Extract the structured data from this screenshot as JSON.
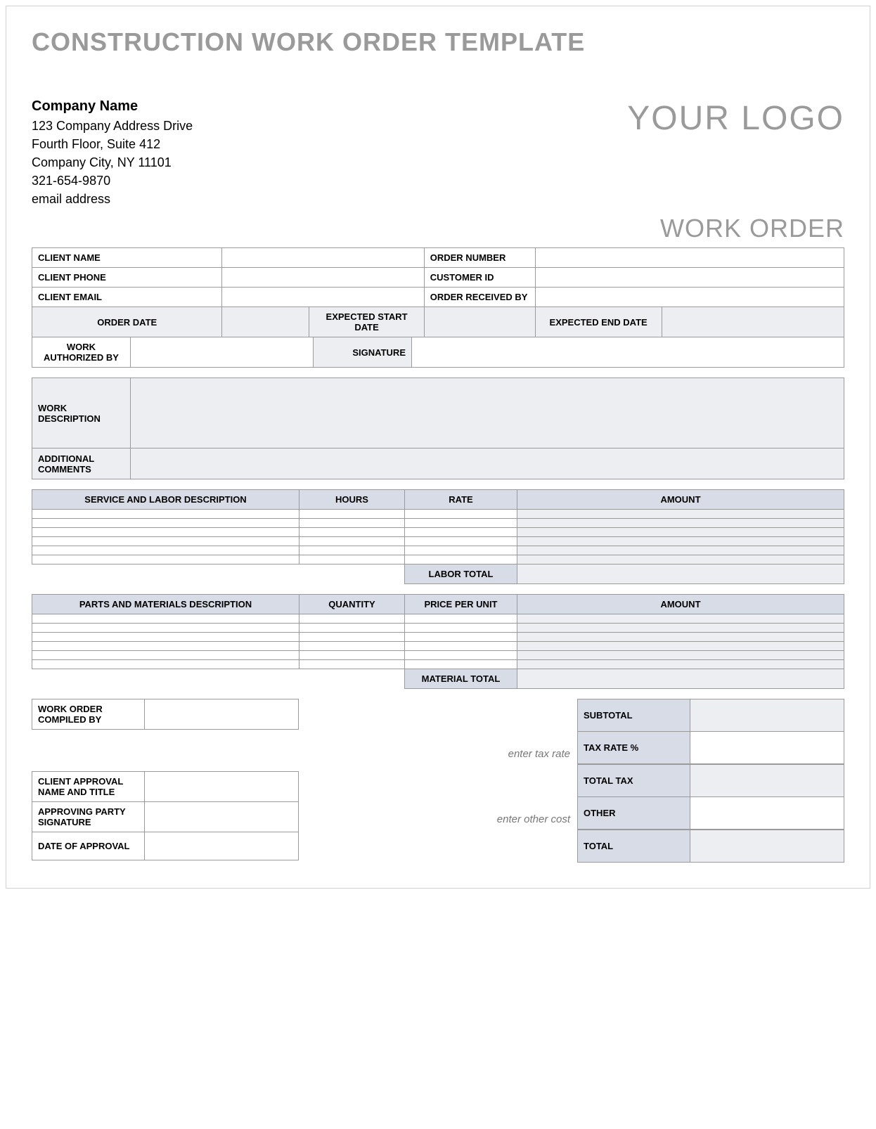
{
  "title": "CONSTRUCTION WORK ORDER TEMPLATE",
  "company": {
    "name": "Company Name",
    "address1": "123 Company Address Drive",
    "address2": "Fourth Floor, Suite 412",
    "city_line": "Company City, NY  11101",
    "phone": "321-654-9870",
    "email": "email address"
  },
  "logo_text": "YOUR LOGO",
  "doc_label": "WORK ORDER",
  "fields": {
    "client_name": "CLIENT NAME",
    "client_phone": "CLIENT PHONE",
    "client_email": "CLIENT EMAIL",
    "order_number": "ORDER NUMBER",
    "customer_id": "CUSTOMER ID",
    "order_received_by": "ORDER RECEIVED BY",
    "order_date": "ORDER DATE",
    "expected_start": "EXPECTED START DATE",
    "expected_end": "EXPECTED END DATE",
    "work_auth_by": "WORK AUTHORIZED BY",
    "signature": "SIGNATURE",
    "work_description": "WORK DESCRIPTION",
    "additional_comments": "ADDITIONAL COMMENTS"
  },
  "labor": {
    "headers": {
      "description": "SERVICE AND LABOR DESCRIPTION",
      "hours": "HOURS",
      "rate": "RATE",
      "amount": "AMOUNT"
    },
    "total_label": "LABOR TOTAL",
    "rows": [
      "",
      "",
      "",
      "",
      "",
      ""
    ]
  },
  "materials": {
    "headers": {
      "description": "PARTS AND MATERIALS DESCRIPTION",
      "quantity": "QUANTITY",
      "price": "PRICE PER UNIT",
      "amount": "AMOUNT"
    },
    "total_label": "MATERIAL TOTAL",
    "rows": [
      "",
      "",
      "",
      "",
      "",
      ""
    ]
  },
  "compiled": {
    "label": "WORK ORDER COMPILED BY"
  },
  "approval": {
    "name_title": "CLIENT APPROVAL NAME AND TITLE",
    "signature": "APPROVING PARTY SIGNATURE",
    "date": "DATE OF APPROVAL"
  },
  "hints": {
    "tax_rate": "enter tax rate",
    "other_cost": "enter other cost"
  },
  "summary": {
    "subtotal": "SUBTOTAL",
    "tax_rate": "TAX RATE %",
    "total_tax": "TOTAL TAX",
    "other": "OTHER",
    "total": "TOTAL"
  }
}
